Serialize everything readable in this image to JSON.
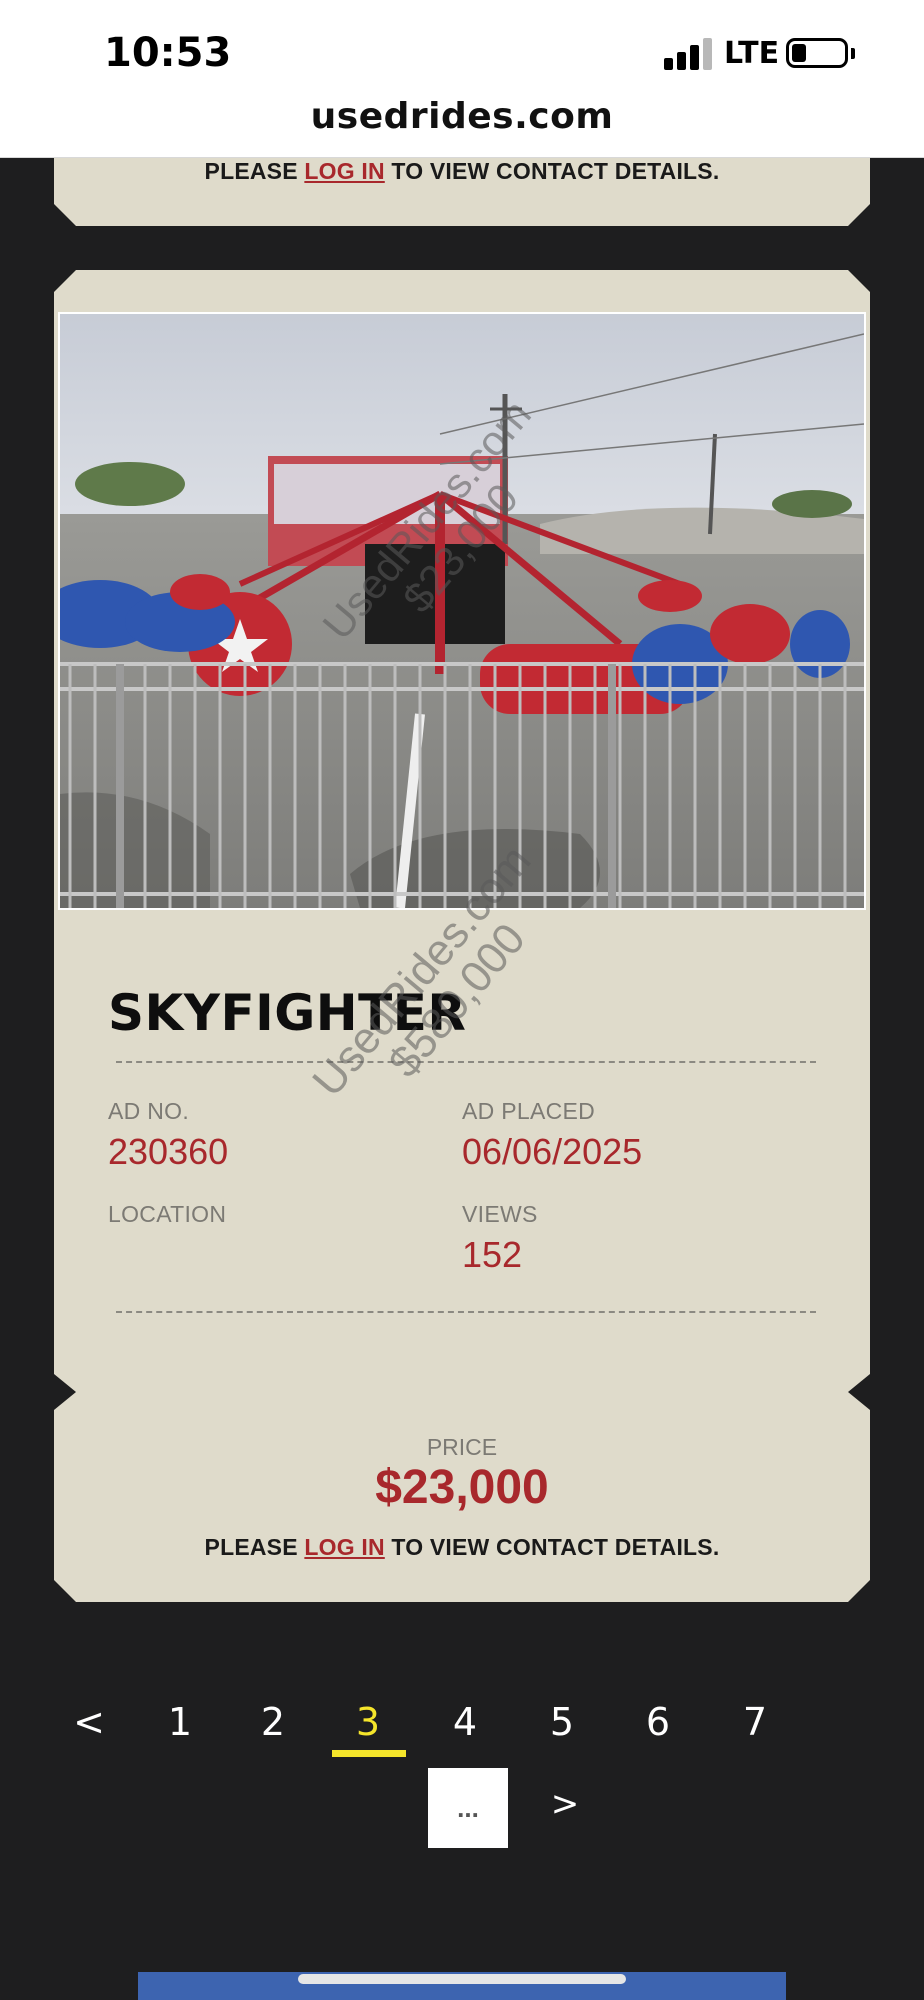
{
  "status": {
    "time": "10:53",
    "network": "LTE"
  },
  "browser": {
    "url": "usedrides.com"
  },
  "contact": {
    "prefix": "PLEASE ",
    "login": "LOG IN",
    "suffix": " TO VIEW CONTACT DETAILS."
  },
  "listing": {
    "title": "SKYFIGHTER",
    "ad_no_label": "AD NO.",
    "ad_no": "230360",
    "ad_placed_label": "AD PLACED",
    "ad_placed": "06/06/2025",
    "location_label": "LOCATION",
    "location": "",
    "views_label": "VIEWS",
    "views": "152",
    "price_label": "PRICE",
    "price": "$23,000",
    "photo_watermark_site": "UsedRides.com",
    "photo_watermark_price": "$23,000",
    "overlay_watermark_site": "UsedRides.com",
    "overlay_watermark_price": "$580,000"
  },
  "pagination": {
    "prev": "<",
    "pages": [
      "1",
      "2",
      "3",
      "4",
      "5",
      "6",
      "7"
    ],
    "current": "3",
    "more": "...",
    "next": ">"
  },
  "colors": {
    "accent": "#a8282c",
    "card": "#dfdbcb",
    "active_page": "#f5e52b",
    "background": "#1e1e1f"
  }
}
